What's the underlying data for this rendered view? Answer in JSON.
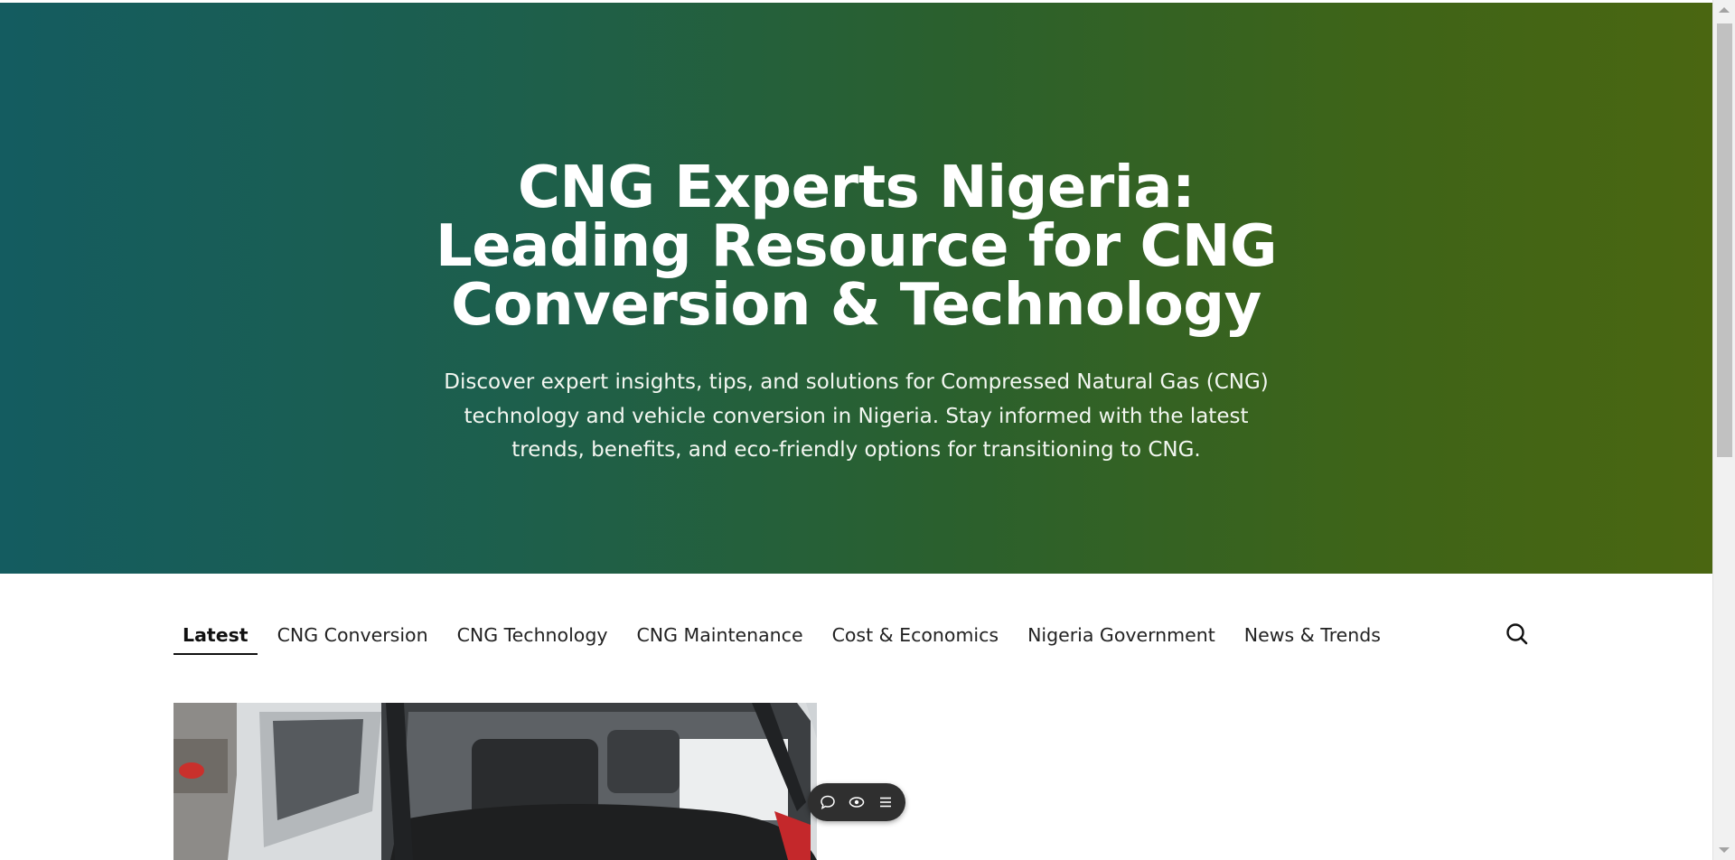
{
  "hero": {
    "title_lines": [
      "CNG Experts Nigeria:",
      "Leading Resource for CNG",
      "Conversion & Technology"
    ],
    "description": "Discover expert insights, tips, and solutions for Compressed Natural Gas (CNG) technology and vehicle conversion in Nigeria. Stay informed with the latest trends, benefits, and eco-friendly options for transitioning to CNG.",
    "gradient_start": "#145c60",
    "gradient_end": "#4a6611"
  },
  "nav": {
    "tabs": [
      {
        "label": "Latest",
        "active": true
      },
      {
        "label": "CNG Conversion",
        "active": false
      },
      {
        "label": "CNG Technology",
        "active": false
      },
      {
        "label": "CNG Maintenance",
        "active": false
      },
      {
        "label": "Cost & Economics",
        "active": false
      },
      {
        "label": "Nigeria Government",
        "active": false
      },
      {
        "label": "News & Trends",
        "active": false
      }
    ],
    "search_icon": "search-icon"
  },
  "latest_post": {
    "image_icon": "car-trunk-photo"
  },
  "floating_toolbar": {
    "buttons": [
      "comment-icon",
      "eye-icon",
      "menu-icon"
    ]
  }
}
